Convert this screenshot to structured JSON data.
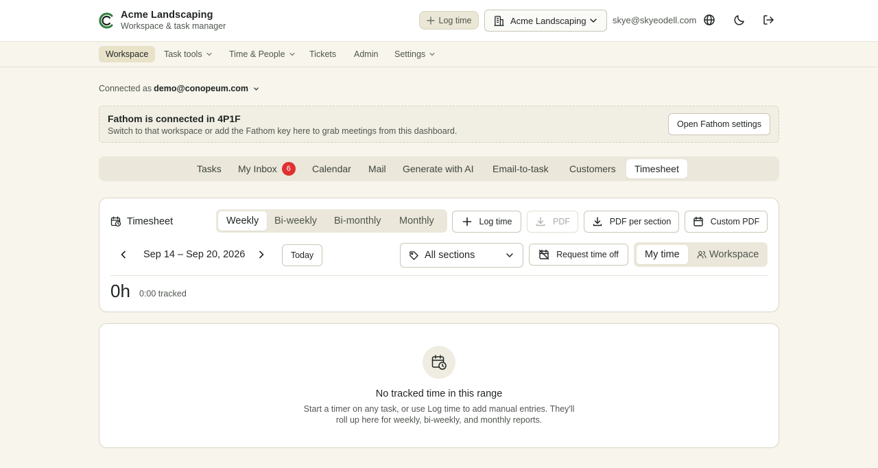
{
  "brand": {
    "name": "Acme Landscaping",
    "subtitle": "Workspace & task manager"
  },
  "header": {
    "log_time": "Log time",
    "workspace_select": "Acme Landscaping",
    "user_email": "skye@skyeodell.com",
    "icons": [
      "globe-icon",
      "moon-icon",
      "logout-icon"
    ]
  },
  "nav": [
    {
      "label": "Workspace",
      "active": true
    },
    {
      "label": "Task tools",
      "dropdown": true
    },
    {
      "label": "Time & People",
      "dropdown": true
    },
    {
      "label": "Tickets"
    },
    {
      "label": "Admin"
    },
    {
      "label": "Settings",
      "dropdown": true
    }
  ],
  "connected": {
    "prefix": "Connected as",
    "account": "demo@conopeum.com"
  },
  "fathom": {
    "title": "Fathom is connected in 4P1F",
    "description": "Switch to that workspace or add the Fathom key here to grab meetings from this dashboard.",
    "button": "Open Fathom settings"
  },
  "tabs": [
    {
      "label": "Tasks"
    },
    {
      "label": "My Inbox",
      "badge": "6"
    },
    {
      "label": "Calendar"
    },
    {
      "label": "Mail"
    },
    {
      "label": "Generate with AI"
    },
    {
      "label": "Email-to-task"
    },
    {
      "label": "Customers"
    },
    {
      "label": "Timesheet",
      "active": true
    }
  ],
  "timesheet": {
    "title": "Timesheet",
    "periods": [
      "Weekly",
      "Bi-weekly",
      "Bi-monthly",
      "Monthly"
    ],
    "active_period": "Weekly",
    "log_time": "Log time",
    "pdf": "PDF",
    "pdf_per_section": "PDF per section",
    "custom_pdf": "Custom PDF",
    "date_range": "Sep 14 – Sep 20, 2026",
    "today": "Today",
    "sections": "All sections",
    "request_time_off": "Request time off",
    "scope": [
      "My time",
      "Workspace"
    ],
    "active_scope": "My time",
    "total": "0h",
    "tracked": "0:00 tracked"
  },
  "empty": {
    "title": "No tracked time in this range",
    "description": "Start a timer on any task, or use Log time to add manual entries. They'll roll up here for weekly, bi-weekly, and monthly reports."
  },
  "colors": {
    "accent_green": "#2f7d3a",
    "active_nav_bg": "#e8e2c8",
    "badge_red": "#e03131"
  }
}
